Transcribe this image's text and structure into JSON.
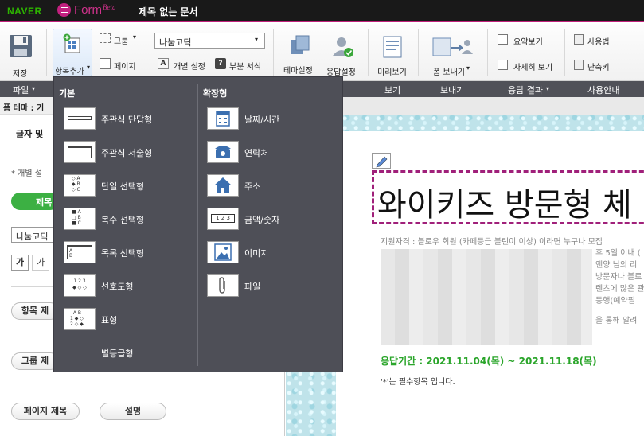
{
  "brand": {
    "naver": "NAVER",
    "form": "Form",
    "beta": "Beta"
  },
  "doc_title": "제목 없는 문서",
  "ribbon": {
    "save": "저장",
    "add_item": "항목추가",
    "group": "그룹",
    "page": "페이지",
    "font_value": "나눔고딕",
    "individual_settings": "개별 설정",
    "secondary_format": "부분 서식",
    "theme_settings": "테마설정",
    "response_settings": "응답설정",
    "preview": "미리보기",
    "send_form": "폼 보내기",
    "summary_view": "요약보기",
    "detail_view": "자세히 보기",
    "usage": "사용법",
    "shortcut": "단축키"
  },
  "categories": [
    "파일",
    "보기",
    "보내기",
    "응답 결과",
    "사용안내"
  ],
  "left_panel": {
    "theme_label": "폼 테마 : 기",
    "font_section": "글자 및 ",
    "individual_note": "* 개별 설",
    "green_button": "제목",
    "font_value": "나눔고딕",
    "bold_glyph": "가",
    "italic_glyph": "가",
    "item_button": "항목 제",
    "group_button": "그룹 제",
    "page_title_button": "페이지 제목",
    "description_button": "설명"
  },
  "menu": {
    "basic_header": "기본",
    "extended_header": "확장형",
    "basic_items": [
      {
        "label": "주관식 단답형",
        "icon": "short-answer-icon"
      },
      {
        "label": "주관식 서술형",
        "icon": "long-answer-icon"
      },
      {
        "label": "단일 선택형",
        "icon": "single-choice-icon"
      },
      {
        "label": "복수 선택형",
        "icon": "multiple-choice-icon"
      },
      {
        "label": "목록 선택형",
        "icon": "dropdown-list-icon"
      },
      {
        "label": "선호도형",
        "icon": "preference-icon"
      },
      {
        "label": "표형",
        "icon": "table-grid-icon"
      },
      {
        "label": "별등급형",
        "icon": "star-rating-icon"
      }
    ],
    "extended_items": [
      {
        "label": "날짜/시간",
        "icon": "calendar-icon"
      },
      {
        "label": "연락처",
        "icon": "phone-icon"
      },
      {
        "label": "주소",
        "icon": "home-icon"
      },
      {
        "label": "금액/숫자",
        "icon": "number-icon"
      },
      {
        "label": "이미지",
        "icon": "image-icon"
      },
      {
        "label": "파일",
        "icon": "paperclip-icon"
      }
    ]
  },
  "form": {
    "title": "와이키즈 방문형 체",
    "qualification": "지원자격 : 블로우 회원 (카페등급 블린이 이상) 이라면 누구나 모집",
    "body_lines": [
      "후 5일 이내 (",
      "앤양 님의 리",
      "방문자나 블로",
      "렌츠에 많은 관",
      "동행(예약필",
      "을 통해 알려"
    ],
    "period": "응답기간 : 2021.11.04(목) ~ 2021.11.18(목)",
    "required_note": "'*'는 필수항목 입니다."
  },
  "colors": {
    "accent": "#c0207a",
    "naver_green": "#2db400",
    "period_green": "#2aa52a",
    "menu_bg": "#4e4f57"
  }
}
